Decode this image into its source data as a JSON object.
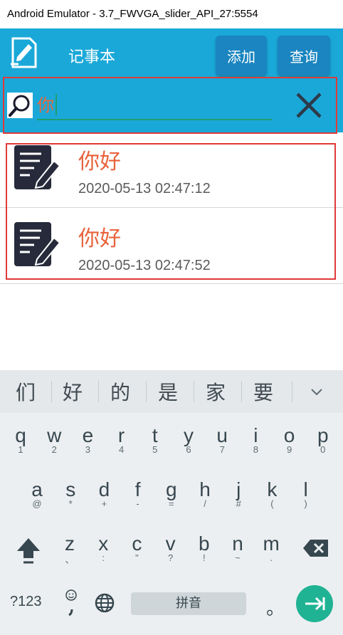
{
  "window": {
    "title": "Android Emulator - 3.7_FWVGA_slider_API_27:5554"
  },
  "appbar": {
    "title": "记事本",
    "add_label": "添加",
    "query_label": "查询"
  },
  "search": {
    "value": "你"
  },
  "notes": [
    {
      "title": "你好",
      "date": "2020-05-13 02:47:12"
    },
    {
      "title": "你好",
      "date": "2020-05-13 02:47:52"
    }
  ],
  "keyboard": {
    "candidates": [
      "们",
      "好",
      "的",
      "是",
      "家",
      "要"
    ],
    "row1": [
      {
        "m": "q",
        "s": "1"
      },
      {
        "m": "w",
        "s": "2"
      },
      {
        "m": "e",
        "s": "3"
      },
      {
        "m": "r",
        "s": "4"
      },
      {
        "m": "t",
        "s": "5"
      },
      {
        "m": "y",
        "s": "6"
      },
      {
        "m": "u",
        "s": "7"
      },
      {
        "m": "i",
        "s": "8"
      },
      {
        "m": "o",
        "s": "9"
      },
      {
        "m": "p",
        "s": "0"
      }
    ],
    "row2": [
      {
        "m": "a",
        "s": "@"
      },
      {
        "m": "s",
        "s": "*"
      },
      {
        "m": "d",
        "s": "+"
      },
      {
        "m": "f",
        "s": "-"
      },
      {
        "m": "g",
        "s": "="
      },
      {
        "m": "h",
        "s": "/"
      },
      {
        "m": "j",
        "s": "#"
      },
      {
        "m": "k",
        "s": "("
      },
      {
        "m": "l",
        "s": ")"
      }
    ],
    "row3": [
      {
        "m": "z",
        "s": "、"
      },
      {
        "m": "x",
        "s": ":"
      },
      {
        "m": "c",
        "s": "\""
      },
      {
        "m": "v",
        "s": "?"
      },
      {
        "m": "b",
        "s": "!"
      },
      {
        "m": "n",
        "s": "~"
      },
      {
        "m": "m",
        "s": "."
      }
    ],
    "symbols_label": "?123",
    "space_label": "拼音",
    "period_label": "。"
  },
  "colors": {
    "accent": "#1aa8d8",
    "button": "#1a85c0",
    "highlight": "#e03a3a",
    "note_title": "#e8623a",
    "enter": "#1fb394"
  }
}
